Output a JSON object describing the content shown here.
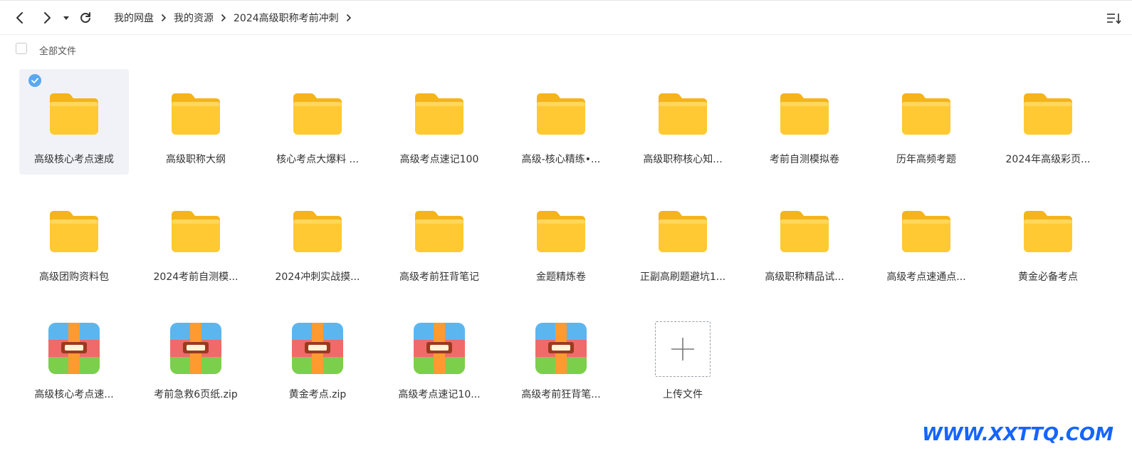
{
  "breadcrumb": {
    "items": [
      "我的网盘",
      "我的资源",
      "2024高级职称考前冲刺"
    ]
  },
  "toolbar": {
    "back_icon": "chevron-left-icon",
    "forward_icon": "chevron-right-icon",
    "history_icon": "caret-down-icon",
    "refresh_icon": "refresh-icon",
    "sort_icon": "sort-list-icon"
  },
  "subbar": {
    "all_files_label": "全部文件"
  },
  "files": [
    {
      "name": "高级核心考点速成",
      "type": "folder",
      "selected": true
    },
    {
      "name": "高级职称大纲",
      "type": "folder"
    },
    {
      "name": "核心考点大爆料 ...",
      "type": "folder"
    },
    {
      "name": "高级考点速记100",
      "type": "folder"
    },
    {
      "name": "高级-核心精练•...",
      "type": "folder"
    },
    {
      "name": "高级职称核心知...",
      "type": "folder"
    },
    {
      "name": "考前自测模拟卷",
      "type": "folder"
    },
    {
      "name": "历年高频考题",
      "type": "folder"
    },
    {
      "name": "2024年高级彩页...",
      "type": "folder"
    },
    {
      "name": "高级团购资料包",
      "type": "folder"
    },
    {
      "name": "2024考前自测模...",
      "type": "folder"
    },
    {
      "name": "2024冲刺实战摸...",
      "type": "folder"
    },
    {
      "name": "高级考前狂背笔记",
      "type": "folder"
    },
    {
      "name": "金题精炼卷",
      "type": "folder"
    },
    {
      "name": "正副高刷题避坑1...",
      "type": "folder"
    },
    {
      "name": "高级职称精品试...",
      "type": "folder"
    },
    {
      "name": "高级考点速通点...",
      "type": "folder"
    },
    {
      "name": "黄金必备考点",
      "type": "folder"
    },
    {
      "name": "高级核心考点速...",
      "type": "zip"
    },
    {
      "name": "考前急救6页纸.zip",
      "type": "zip"
    },
    {
      "name": "黄金考点.zip",
      "type": "zip"
    },
    {
      "name": "高级考点速记10...",
      "type": "zip"
    },
    {
      "name": "高级考前狂背笔...",
      "type": "zip"
    }
  ],
  "upload": {
    "label": "上传文件",
    "icon": "plus-icon"
  },
  "watermark": "WWW.XXTTQ.COM",
  "colors": {
    "folder": "#ffc933",
    "accent": "#1565ff",
    "check": "#5aa8f0"
  }
}
